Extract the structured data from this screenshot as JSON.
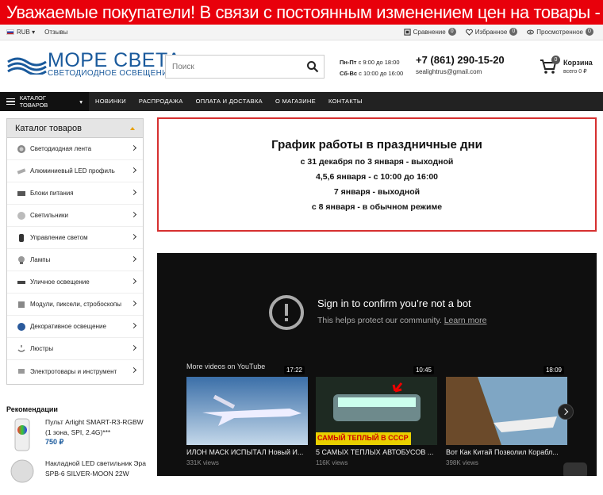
{
  "banner": {
    "text": "Уважаемые покупатели! В связи с постоянным изменением цен на товары - уточняйте актуальную цену по т"
  },
  "topbar": {
    "currency": "RUB",
    "reviews": "Отзывы",
    "compare_label": "Сравнение",
    "compare_count": "0",
    "favorites_label": "Избранное",
    "favorites_count": "0",
    "viewed_label": "Просмотренное",
    "viewed_count": "0"
  },
  "header": {
    "logo_title": "МОРЕ СВЕТА",
    "logo_subtitle": "СВЕТОДИОДНОЕ ОСВЕЩЕНИЕ",
    "search_placeholder": "Поиск",
    "hours_weekday_label": "Пн-Пт",
    "hours_weekday": "с 9:00 до 18:00",
    "hours_weekend_label": "Сб-Вс",
    "hours_weekend": "с 10:00 до 16:00",
    "phone": "+7 (861) 290-15-20",
    "email": "sealightrus@gmail.com",
    "cart_count": "0",
    "cart_label": "Корзина",
    "cart_total": "всего 0 ₽"
  },
  "nav": {
    "catalog": "КАТАЛОГ ТОВАРОВ",
    "items": [
      "НОВИНКИ",
      "РАСПРОДАЖА",
      "ОПЛАТА И ДОСТАВКА",
      "О МАГАЗИНЕ",
      "КОНТАКТЫ"
    ]
  },
  "sidebar": {
    "title": "Каталог товаров",
    "items": [
      {
        "label": "Светодиодная лента",
        "icon": "led-strip-icon"
      },
      {
        "label": "Алюминиевый LED профиль",
        "icon": "profile-icon"
      },
      {
        "label": "Блоки питания",
        "icon": "power-supply-icon"
      },
      {
        "label": "Светильники",
        "icon": "lamp-fixture-icon"
      },
      {
        "label": "Управление светом",
        "icon": "controller-icon"
      },
      {
        "label": "Лампы",
        "icon": "bulb-icon"
      },
      {
        "label": "Уличное освещение",
        "icon": "street-light-icon"
      },
      {
        "label": "Модули, пиксели, стробоскопы",
        "icon": "module-icon"
      },
      {
        "label": "Декоративное освещение",
        "icon": "decor-icon"
      },
      {
        "label": "Люстры",
        "icon": "chandelier-icon"
      },
      {
        "label": "Электротовары и инструмент",
        "icon": "tools-icon"
      }
    ]
  },
  "recommendations": {
    "title": "Рекомендации",
    "items": [
      {
        "name": "Пульт Arlight SMART-R3-RGBW (1 зона, SPI, 2.4G)***",
        "price": "750 ₽"
      },
      {
        "name": "Накладной LED светильник Эра SPB-6 SILVER-MOON 22W",
        "price": ""
      }
    ]
  },
  "notice": {
    "title": "График работы в праздничные дни",
    "lines": [
      "с 31 декабря по 3 января - выходной",
      "4,5,6 января - с 10:00 до 16:00",
      "7 января - выходной",
      "с 8 января - в обычном режиме"
    ]
  },
  "youtube": {
    "title": "Sign in to confirm you’re not a bot",
    "subtitle": "This helps protect our community.",
    "learn_more": "Learn more",
    "more_videos": "More videos on YouTube",
    "videos": [
      {
        "title": "ИЛОН МАСК ИСПЫТАЛ Новый И...",
        "views": "331K views",
        "duration": "17:22"
      },
      {
        "title": "5 САМЫХ ТЕПЛЫХ АВТОБУСОВ ...",
        "views": "116K views",
        "duration": "10:45",
        "overlay": "САМЫЙ ТЕПЛЫЙ В СССР"
      },
      {
        "title": "Вот Как Китай Позволил Корабл...",
        "views": "398K views",
        "duration": "18:09"
      }
    ]
  },
  "colors": {
    "banner": "#e8000b",
    "brand": "#1a5a9c",
    "nav": "#222222",
    "notice_border": "#d63030"
  }
}
